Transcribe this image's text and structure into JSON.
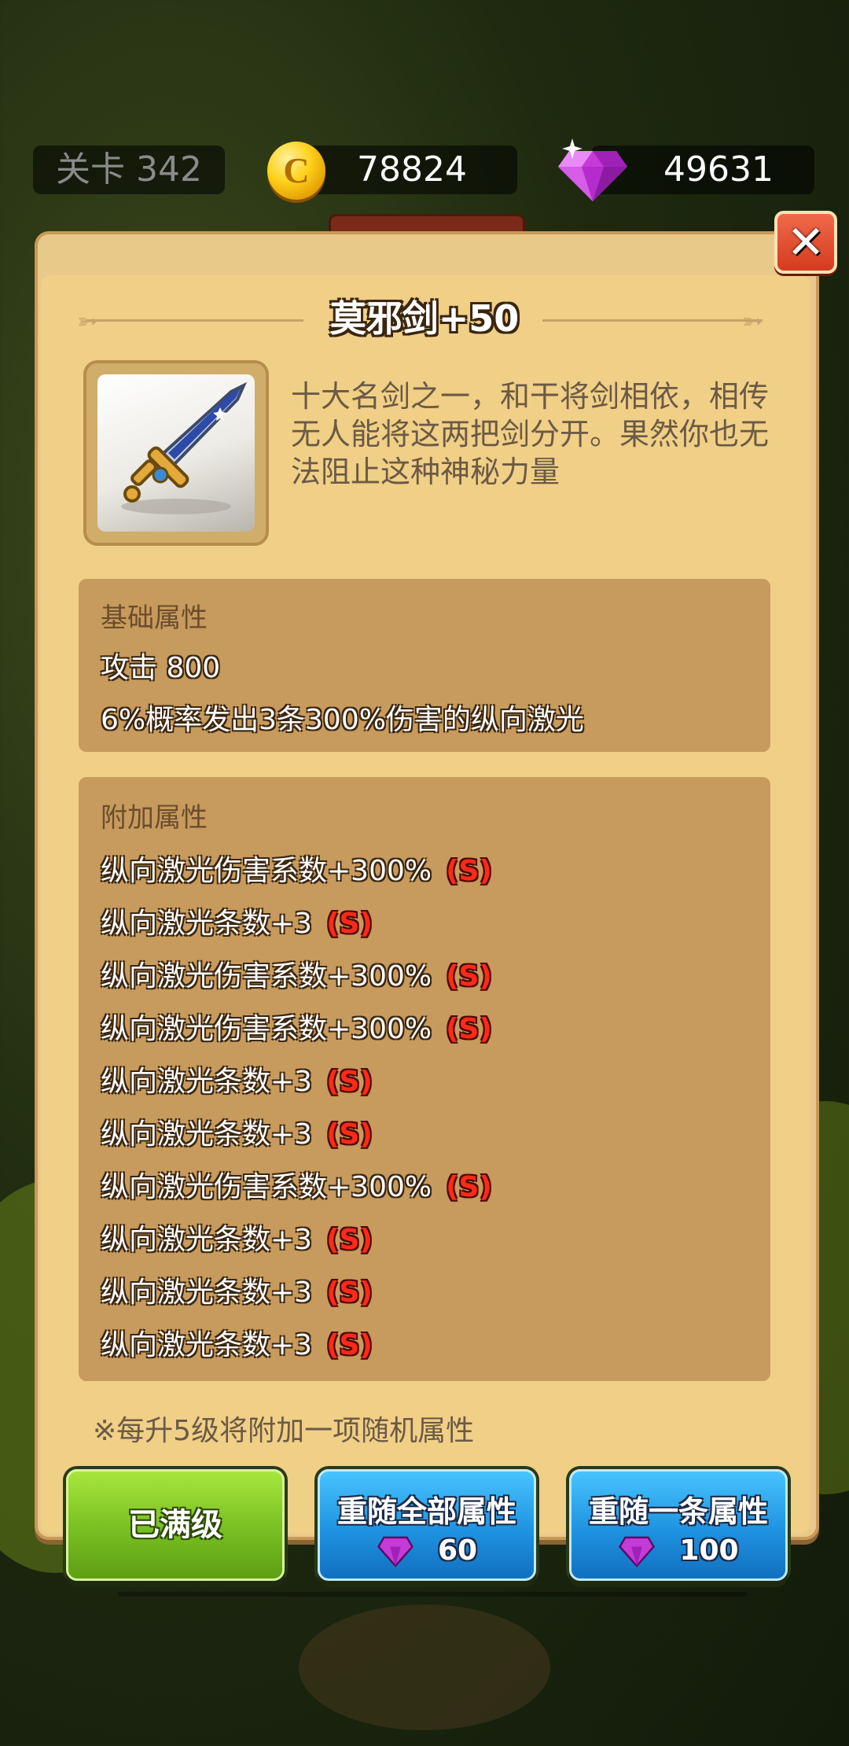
{
  "hud": {
    "level": "关卡 342",
    "coins": "78824",
    "coin_symbol": "C",
    "coin_icon": "gold-coin-icon",
    "gems": "49631",
    "gem_icon": "purple-diamond-icon"
  },
  "dialog": {
    "title": "莫邪剑+50",
    "item_icon": "sword-icon",
    "description": "十大名剑之一，和干将剑相依，相传无人能将这两把剑分开。果然你也无法阻止这种神秘力量",
    "close_icon": "close-icon",
    "base_header": "基础属性",
    "base_stats": [
      "攻击 800",
      "6%概率发出3条300%伤害的纵向激光"
    ],
    "extra_header": "附加属性",
    "extra_stats": [
      {
        "text": "纵向激光伤害系数+300%",
        "badge": "(S)"
      },
      {
        "text": "纵向激光条数+3",
        "badge": "(S)"
      },
      {
        "text": "纵向激光伤害系数+300%",
        "badge": "(S)"
      },
      {
        "text": "纵向激光伤害系数+300%",
        "badge": "(S)"
      },
      {
        "text": "纵向激光条数+3",
        "badge": "(S)"
      },
      {
        "text": "纵向激光条数+3",
        "badge": "(S)"
      },
      {
        "text": "纵向激光伤害系数+300%",
        "badge": "(S)"
      },
      {
        "text": "纵向激光条数+3",
        "badge": "(S)"
      },
      {
        "text": "纵向激光条数+3",
        "badge": "(S)"
      },
      {
        "text": "纵向激光条数+3",
        "badge": "(S)"
      }
    ],
    "note": "※每升5级将附加一项随机属性"
  },
  "buttons": {
    "max_level": "已满级",
    "reroll_all": {
      "label": "重随全部属性",
      "cost": "60"
    },
    "reroll_one": {
      "label": "重随一条属性",
      "cost": "100"
    }
  },
  "colors": {
    "panel": "#f0cf87",
    "stat_box": "#c79a5d",
    "badge_red": "#ff2a1a",
    "button_green": "#7cc223",
    "button_blue": "#1f93e0"
  }
}
